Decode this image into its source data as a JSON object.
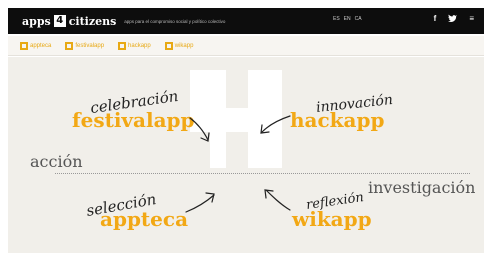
{
  "header": {
    "brand_left": "apps",
    "brand_logo": "4",
    "brand_right": "citizens",
    "tagline": "apps para el compromiso social y político colectivo",
    "languages": [
      "ES",
      "EN",
      "CA"
    ],
    "social_icons": [
      "facebook-icon",
      "twitter-icon",
      "menu-icon"
    ]
  },
  "subnav": {
    "items": [
      {
        "label": "appteca"
      },
      {
        "label": "festivalapp"
      },
      {
        "label": "hackapp"
      },
      {
        "label": "wikapp"
      }
    ]
  },
  "hero": {
    "axis_left": "acción",
    "axis_right": "investigación",
    "quadrants": {
      "festivalapp": {
        "title": "festivalapp",
        "handwriting": "celebración"
      },
      "hackapp": {
        "title": "hackapp",
        "handwriting": "innovación"
      },
      "appteca": {
        "title": "appteca",
        "handwriting": "selección"
      },
      "wikapp": {
        "title": "wikapp",
        "handwriting": "reflexión"
      }
    }
  },
  "colors": {
    "accent": "#f2a815",
    "topbar": "#0d0d0d",
    "hero_bg": "#f1efea"
  }
}
